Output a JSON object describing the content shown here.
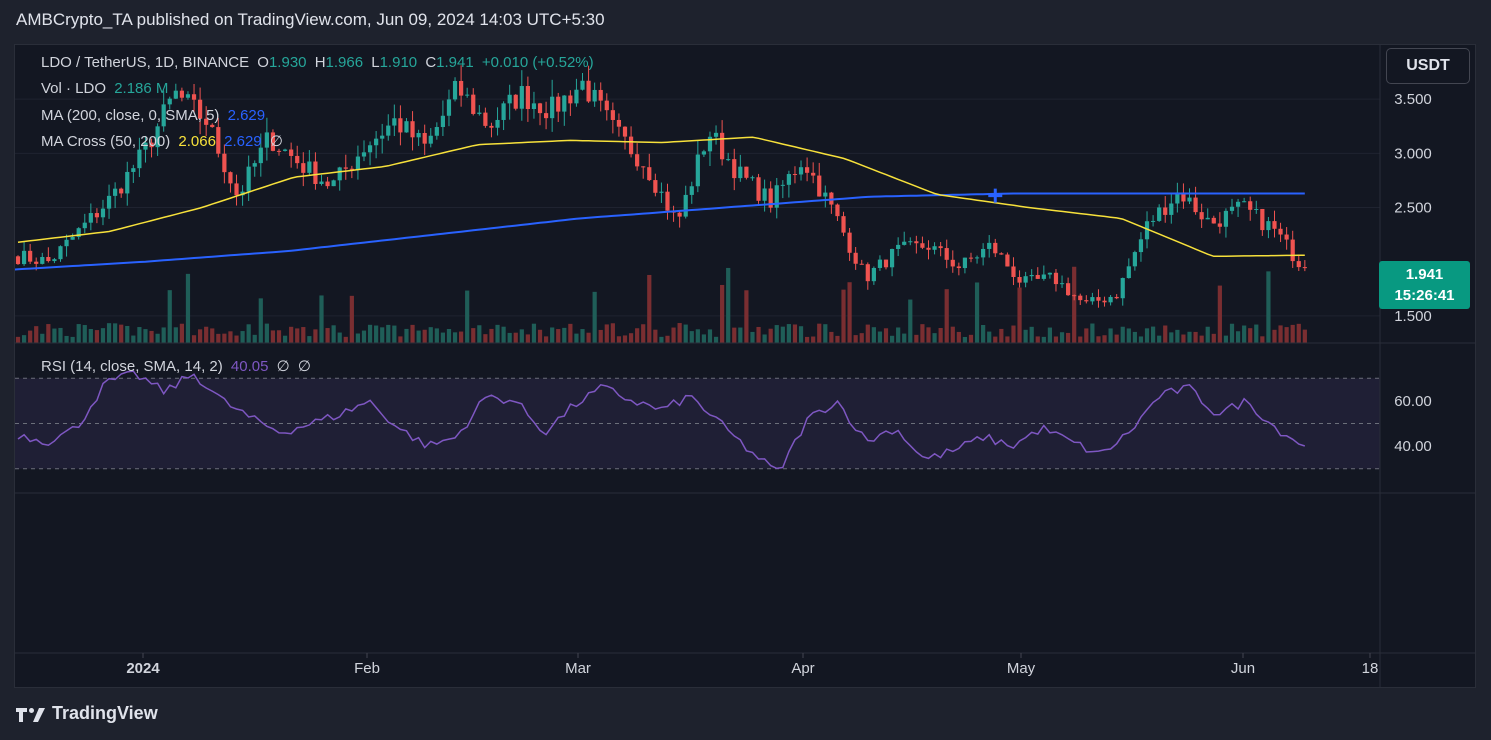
{
  "header": {
    "published": "AMBCrypto_TA published on TradingView.com, Jun 09, 2024 14:03 UTC+5:30"
  },
  "legend": {
    "symbol": "LDO / TetherUS, 1D, BINANCE",
    "o_label": "O",
    "o": "1.930",
    "h_label": "H",
    "h": "1.966",
    "l_label": "L",
    "l": "1.910",
    "c_label": "C",
    "c": "1.941",
    "change": "+0.010 (+0.52%)",
    "vol_label": "Vol · LDO",
    "vol_value": "2.186 M",
    "ma_label": "MA (200, close, 0, SMA, 5)",
    "ma_value": "2.629",
    "macross_label": "MA Cross (50, 200)",
    "macross_fast": "2.066",
    "macross_slow": "2.629",
    "macross_null": "∅",
    "rsi_label": "RSI (14, close, SMA, 14, 2)",
    "rsi_value": "40.05",
    "rsi_null1": "∅",
    "rsi_null2": "∅"
  },
  "currency_button": "USDT",
  "last_price": {
    "value": "1.941",
    "countdown": "15:26:41"
  },
  "footer": {
    "brand": "TradingView"
  },
  "colors": {
    "up": "#26a69a",
    "down": "#ef5350",
    "ma50": "#f7e13b",
    "ma200": "#2962ff",
    "rsi": "#7e57c2"
  },
  "chart_data": {
    "type": "candlestick",
    "price_axis": {
      "ticks": [
        "3.500",
        "3.000",
        "2.500",
        "1.500"
      ],
      "tick_values": [
        3.5,
        3.0,
        2.5,
        1.5
      ],
      "range": [
        1.25,
        4.0
      ]
    },
    "rsi_axis": {
      "ticks": [
        "60.00",
        "40.00"
      ],
      "tick_values": [
        60,
        40
      ],
      "bands": [
        30,
        50,
        70
      ]
    },
    "x_axis": {
      "labels": [
        "2024",
        "Feb",
        "Mar",
        "Apr",
        "May",
        "Jun",
        "18"
      ]
    },
    "seed_price": 2.05,
    "targets": [
      2.05,
      2.0,
      2.3,
      2.6,
      3.0,
      3.55,
      3.3,
      2.6,
      3.15,
      2.9,
      2.7,
      3.05,
      3.3,
      3.05,
      3.6,
      3.25,
      3.55,
      3.4,
      3.65,
      3.2,
      2.9,
      2.35,
      3.2,
      2.8,
      2.55,
      2.95,
      2.45,
      1.85,
      2.1,
      2.15,
      1.95,
      2.15,
      1.8,
      1.85,
      1.6,
      1.7,
      2.35,
      2.65,
      2.35,
      2.5,
      2.3,
      1.93
    ],
    "ma50": [
      2.18,
      2.28,
      2.5,
      2.78,
      2.88,
      3.08,
      3.12,
      3.1,
      3.15,
      2.95,
      2.62,
      2.5,
      2.4,
      2.05,
      2.06
    ],
    "ma200": [
      1.92,
      2.0,
      2.1,
      2.25,
      2.4,
      2.5,
      2.6,
      2.63,
      2.63,
      2.63
    ],
    "rsi_targets": [
      45,
      42,
      48,
      68,
      72,
      64,
      72,
      60,
      52,
      46,
      50,
      54,
      60,
      48,
      40,
      44,
      62,
      60,
      46,
      58,
      66,
      60,
      56,
      62,
      50,
      38,
      28,
      52,
      60,
      42,
      48,
      34,
      38,
      44,
      40,
      48,
      42,
      36,
      46,
      62,
      66,
      54,
      60,
      48,
      40
    ],
    "crossover_marker": {
      "date": "2024-04-27",
      "price": 2.61
    }
  }
}
